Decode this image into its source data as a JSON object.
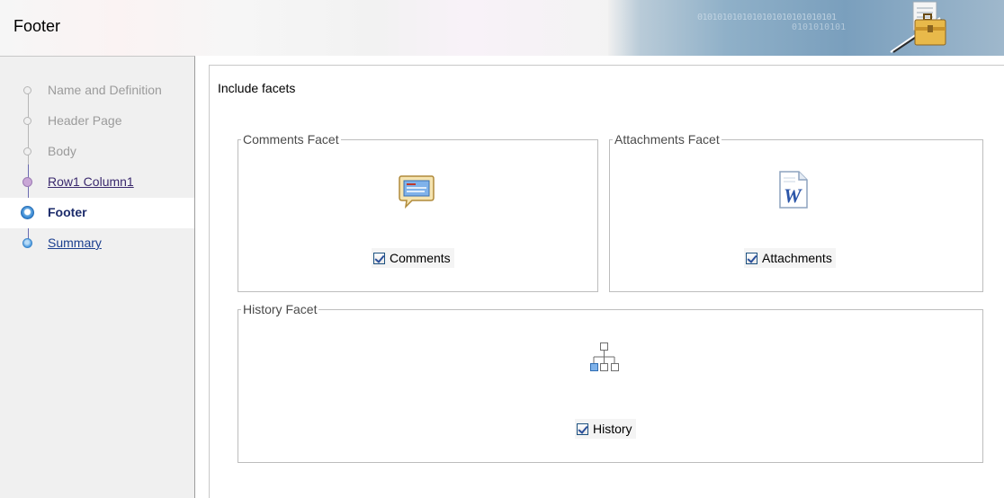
{
  "header": {
    "title": "Footer",
    "binary_line1": "0101010101010101010101010101",
    "binary_line2": "0101010101"
  },
  "train": {
    "steps": [
      {
        "label": "Name and Definition",
        "state": "disabled"
      },
      {
        "label": "Header Page",
        "state": "disabled"
      },
      {
        "label": "Body",
        "state": "disabled"
      },
      {
        "label": "Row1 Column1",
        "state": "visited"
      },
      {
        "label": "Footer",
        "state": "current"
      },
      {
        "label": "Summary",
        "state": "next"
      }
    ]
  },
  "content": {
    "heading": "Include facets",
    "comments_facet": {
      "legend": "Comments Facet",
      "icon": "comment-bubble-icon",
      "checkbox_label": "Comments",
      "checked": true
    },
    "attachments_facet": {
      "legend": "Attachments Facet",
      "icon": "word-document-icon",
      "checkbox_label": "Attachments",
      "checked": true
    },
    "history_facet": {
      "legend": "History Facet",
      "icon": "hierarchy-icon",
      "checkbox_label": "History",
      "checked": true
    }
  }
}
